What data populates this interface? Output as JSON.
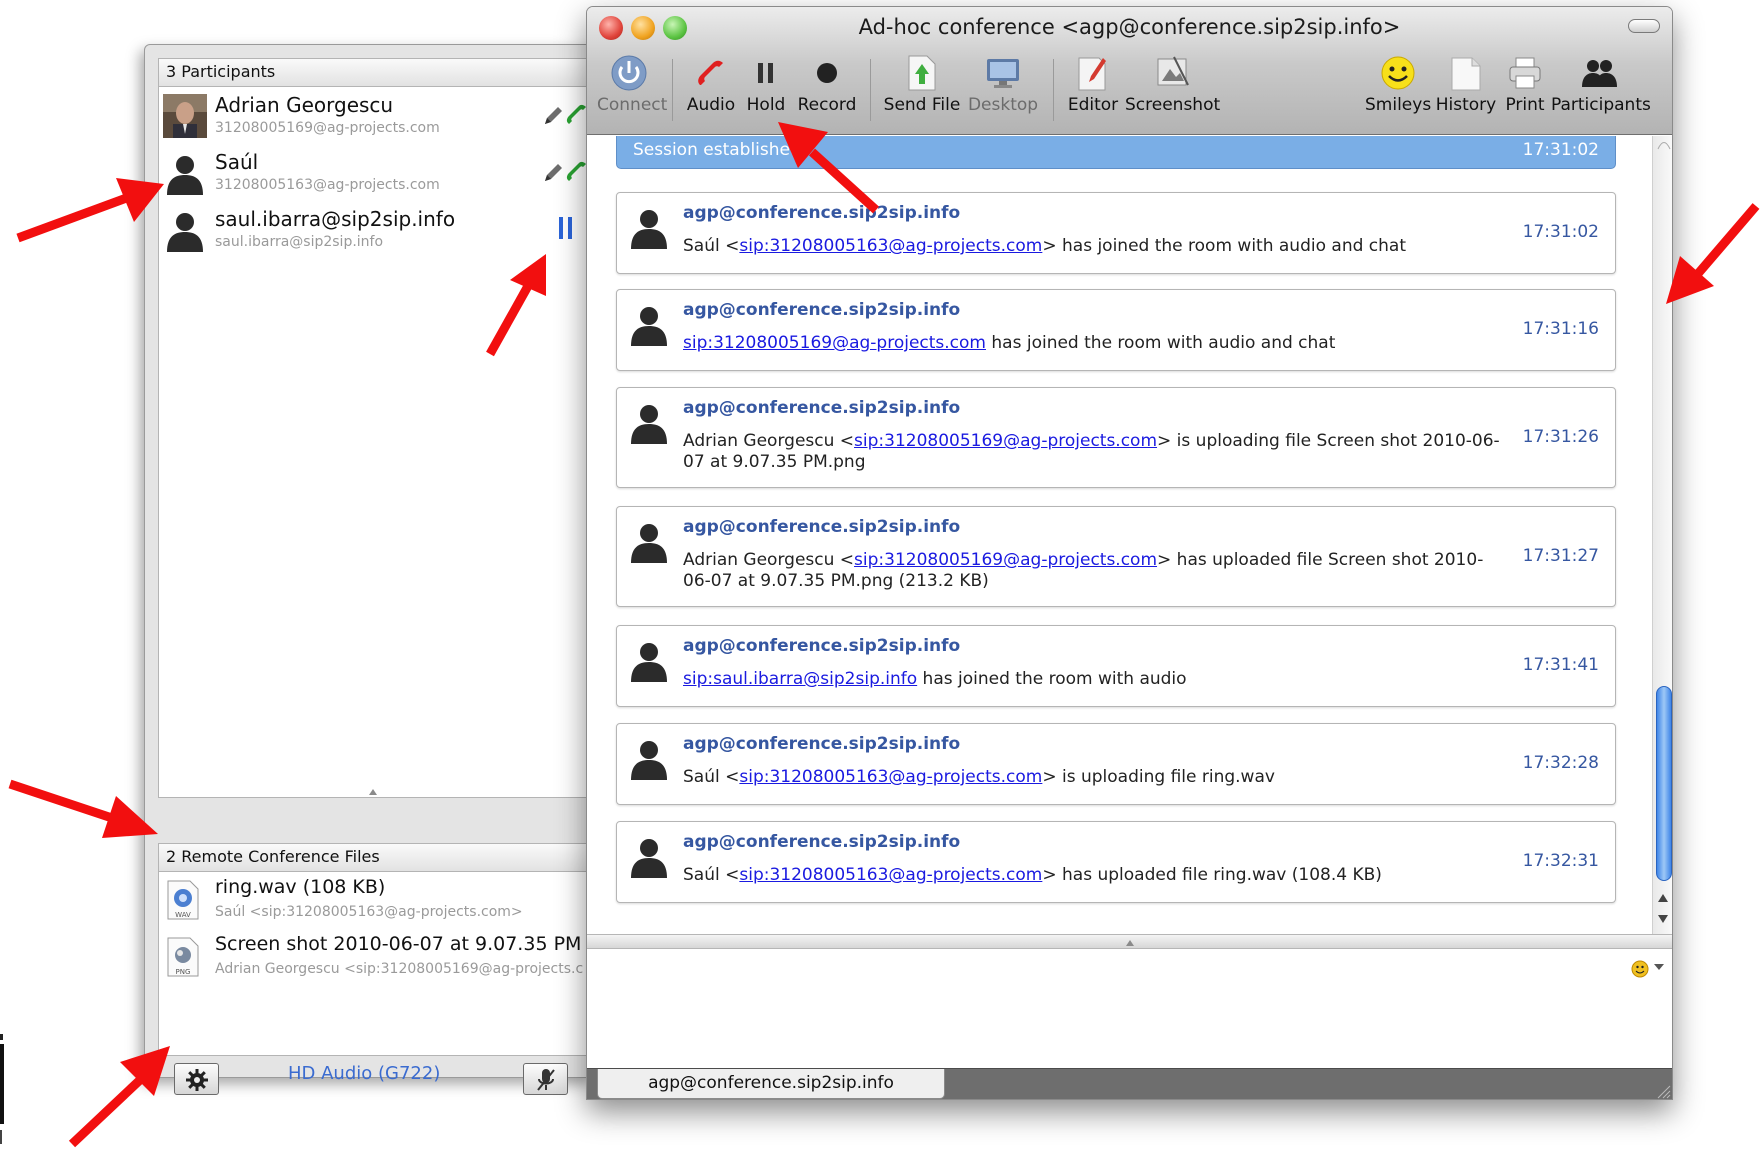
{
  "window": {
    "title": "Ad-hoc conference <agp@conference.sip2sip.info>"
  },
  "toolbar": {
    "connect": "Connect",
    "audio": "Audio",
    "hold": "Hold",
    "record": "Record",
    "send_file": "Send File",
    "desktop": "Desktop",
    "editor": "Editor",
    "screenshot": "Screenshot",
    "smileys": "Smileys",
    "history": "History",
    "print": "Print",
    "participants": "Participants"
  },
  "participants": {
    "header": "3 Participants",
    "items": [
      {
        "name": "Adrian Georgescu",
        "uri": "31208005169@ag-projects.com"
      },
      {
        "name": "Saúl",
        "uri": "31208005163@ag-projects.com"
      },
      {
        "name": "saul.ibarra@sip2sip.info",
        "uri": "saul.ibarra@sip2sip.info"
      }
    ]
  },
  "files": {
    "header": "2 Remote Conference Files",
    "items": [
      {
        "name": "ring.wav (108 KB)",
        "sub": "Saúl <sip:31208005163@ag-projects.com>",
        "type": "WAV"
      },
      {
        "name": "Screen shot 2010-06-07 at 9.07.35 PM",
        "sub": "Adrian Georgescu <sip:31208005169@ag-projects.c",
        "type": "PNG"
      }
    ]
  },
  "drawer_bottom": {
    "codec": "HD Audio (G722)"
  },
  "chat": {
    "session": {
      "text": "Session established",
      "time": "17:31:02"
    },
    "messages": [
      {
        "from": "agp@conference.sip2sip.info",
        "pre": "Saúl <",
        "link": "sip:31208005163@ag-projects.com",
        "post": "> has joined the room with audio and chat",
        "time": "17:31:02"
      },
      {
        "from": "agp@conference.sip2sip.info",
        "pre": "",
        "link": "sip:31208005169@ag-projects.com",
        "post": " has joined the room with audio and chat",
        "time": "17:31:16"
      },
      {
        "from": "agp@conference.sip2sip.info",
        "pre": "Adrian Georgescu <",
        "link": "sip:31208005169@ag-projects.com",
        "post": "> is uploading file Screen shot 2010-06-07 at 9.07.35 PM.png",
        "time": "17:31:26"
      },
      {
        "from": "agp@conference.sip2sip.info",
        "pre": "Adrian Georgescu <",
        "link": "sip:31208005169@ag-projects.com",
        "post": "> has uploaded file Screen shot 2010-06-07 at 9.07.35 PM.png (213.2 KB)",
        "time": "17:31:27"
      },
      {
        "from": "agp@conference.sip2sip.info",
        "pre": "",
        "link": "sip:saul.ibarra@sip2sip.info",
        "post": " has joined the room with audio",
        "time": "17:31:41"
      },
      {
        "from": "agp@conference.sip2sip.info",
        "pre": "Saúl <",
        "link": "sip:31208005163@ag-projects.com",
        "post": "> is uploading file ring.wav",
        "time": "17:32:28"
      },
      {
        "from": "agp@conference.sip2sip.info",
        "pre": "Saúl <",
        "link": "sip:31208005163@ag-projects.com",
        "post": "> has uploaded file ring.wav (108.4 KB)",
        "time": "17:32:31"
      }
    ]
  },
  "tabs": [
    {
      "label": "agp@conference.sip2sip.info"
    }
  ],
  "colors": {
    "accent_blue": "#2b64d8",
    "session_bar": "#7aaee6",
    "sender": "#3657a1",
    "annotation_arrow": "#f20f0f"
  }
}
